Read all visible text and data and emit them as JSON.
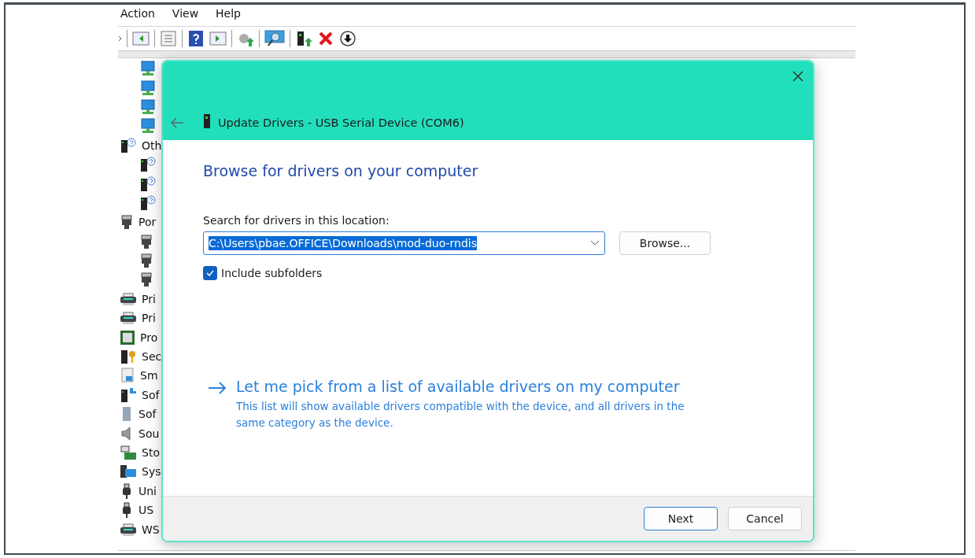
{
  "menu": [
    "Action",
    "View",
    "Help"
  ],
  "toolbar": [
    {
      "kind": "more"
    },
    {
      "kind": "sep"
    },
    {
      "kind": "back"
    },
    {
      "kind": "sep"
    },
    {
      "kind": "properties"
    },
    {
      "kind": "sep"
    },
    {
      "kind": "help"
    },
    {
      "kind": "forward"
    },
    {
      "kind": "sep"
    },
    {
      "kind": "update"
    },
    {
      "kind": "sep"
    },
    {
      "kind": "scan"
    },
    {
      "kind": "sep"
    },
    {
      "kind": "enable"
    },
    {
      "kind": "remove"
    },
    {
      "kind": "download"
    }
  ],
  "tree": {
    "continued_children": [
      {
        "kind": "network"
      },
      {
        "kind": "network"
      },
      {
        "kind": "network"
      },
      {
        "kind": "network"
      }
    ],
    "items": [
      {
        "label": "Oth",
        "kind": "unknown",
        "children": [
          {
            "kind": "unknown"
          },
          {
            "kind": "unknown"
          },
          {
            "kind": "unknown"
          }
        ]
      },
      {
        "label": "Por",
        "kind": "port",
        "children": [
          {
            "kind": "port"
          },
          {
            "kind": "port"
          },
          {
            "kind": "port"
          }
        ]
      },
      {
        "label": "Pri",
        "kind": "printer"
      },
      {
        "label": "Pri",
        "kind": "printer"
      },
      {
        "label": "Pro",
        "kind": "chip"
      },
      {
        "label": "Sec",
        "kind": "security"
      },
      {
        "label": "Sm",
        "kind": "card"
      },
      {
        "label": "Sof",
        "kind": "software"
      },
      {
        "label": "Sof",
        "kind": "tower"
      },
      {
        "label": "Sou",
        "kind": "speaker"
      },
      {
        "label": "Sto",
        "kind": "storage"
      },
      {
        "label": "Sys",
        "kind": "system"
      },
      {
        "label": "Uni",
        "kind": "usb"
      },
      {
        "label": "US",
        "kind": "usb"
      },
      {
        "label": "WS",
        "kind": "printer"
      }
    ]
  },
  "dialog": {
    "title": "Update Drivers - USB Serial Device (COM6)",
    "heading": "Browse for drivers on your computer",
    "location_label": "Search for drivers in this location:",
    "location_value": "C:\\Users\\pbae.OFFICE\\Downloads\\mod-duo-rndis",
    "browse_button": "Browse...",
    "include_subfolders": {
      "label": "Include subfolders",
      "checked": true
    },
    "pick_link": {
      "title": "Let me pick from a list of available drivers on my computer",
      "description": "This list will show available drivers compatible with the device, and all drivers in the same category as the device."
    },
    "buttons": [
      {
        "label": "Next",
        "default": true
      },
      {
        "label": "Cancel",
        "default": false
      }
    ]
  }
}
